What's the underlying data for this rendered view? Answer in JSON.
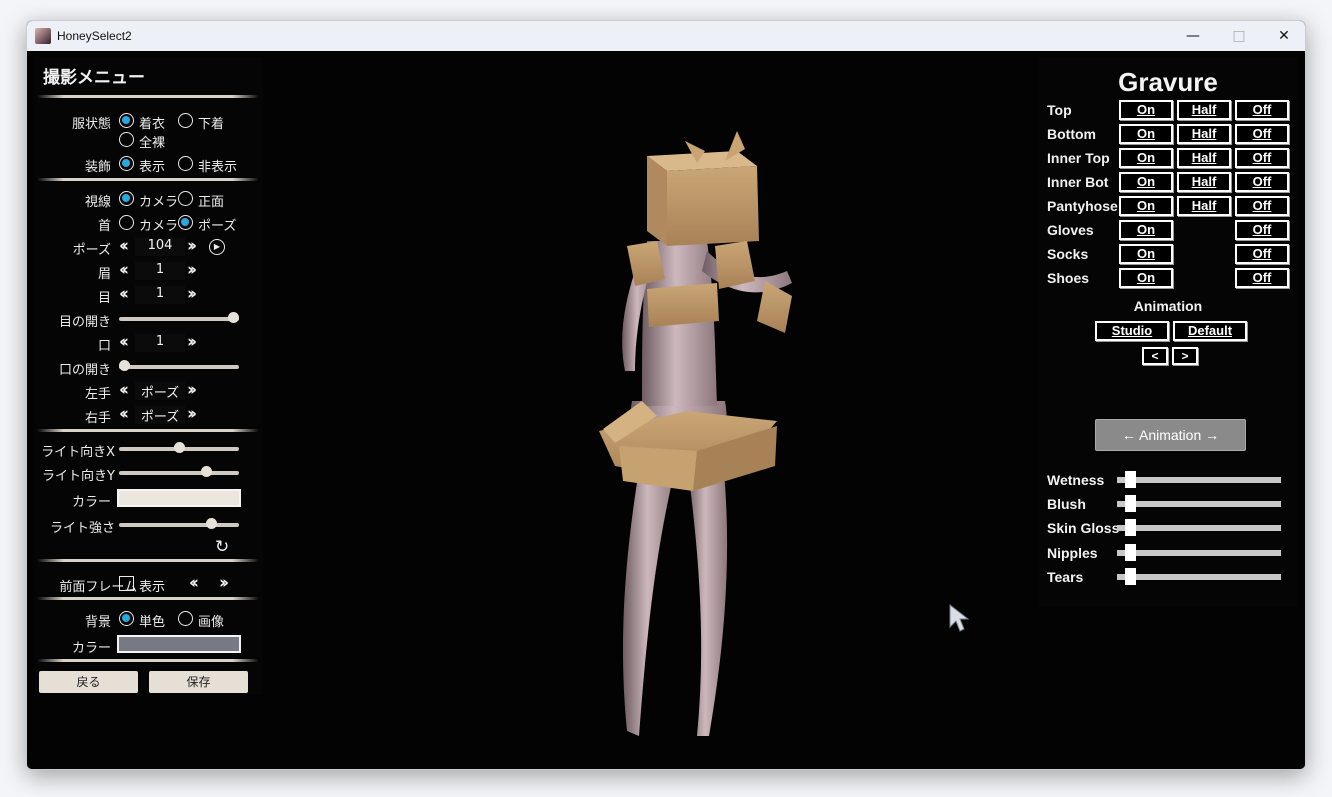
{
  "window": {
    "title": "HoneySelect2"
  },
  "left": {
    "title": "撮影メニュー",
    "clothing": {
      "label": "服状態",
      "opt1": "着衣",
      "opt2": "下着",
      "opt3": "全裸"
    },
    "accessory": {
      "label": "装飾",
      "opt1": "表示",
      "opt2": "非表示"
    },
    "gaze": {
      "label": "視線",
      "opt1": "カメラ",
      "opt2": "正面"
    },
    "neck": {
      "label": "首",
      "opt1": "カメラ",
      "opt2": "ポーズ"
    },
    "pose": {
      "label": "ポーズ",
      "value": "104"
    },
    "brow": {
      "label": "眉",
      "value": "1"
    },
    "eye": {
      "label": "目",
      "value": "1"
    },
    "eye_open": {
      "label": "目の開き",
      "value": 1.0
    },
    "mouth": {
      "label": "口",
      "value": "1"
    },
    "mouth_open": {
      "label": "口の開き",
      "value": 0.0
    },
    "left_hand": {
      "label": "左手",
      "value": "ポーズ"
    },
    "right_hand": {
      "label": "右手",
      "value": "ポーズ"
    },
    "light_x": {
      "label": "ライト向きX",
      "value": 0.5
    },
    "light_y": {
      "label": "ライト向きY",
      "value": 0.75
    },
    "light_color": {
      "label": "カラー",
      "color": "#ede6df"
    },
    "light_strength": {
      "label": "ライト強さ",
      "value": 0.8
    },
    "front_frame": {
      "label": "前面フレーム",
      "checkbox": "表示"
    },
    "background": {
      "label": "背景",
      "opt1": "単色",
      "opt2": "画像"
    },
    "bg_color": {
      "label": "カラー",
      "color": "#777a83"
    },
    "back_button": "戻る",
    "save_button": "保存"
  },
  "right": {
    "title": "Gravure",
    "on": "On",
    "half": "Half",
    "off": "Off",
    "rows": [
      {
        "label": "Top",
        "half": true
      },
      {
        "label": "Bottom",
        "half": true
      },
      {
        "label": "Inner Top",
        "half": true
      },
      {
        "label": "Inner Bot",
        "half": true
      },
      {
        "label": "Pantyhose",
        "half": true
      },
      {
        "label": "Gloves",
        "half": false
      },
      {
        "label": "Socks",
        "half": false
      },
      {
        "label": "Shoes",
        "half": false
      }
    ],
    "animation_label": "Animation",
    "studio": "Studio",
    "default": "Default",
    "prev": "<",
    "next": ">",
    "animation_button": "← Animation →",
    "sliders": [
      {
        "label": "Wetness",
        "value": 0.05
      },
      {
        "label": "Blush",
        "value": 0.05
      },
      {
        "label": "Skin Gloss",
        "value": 0.05
      },
      {
        "label": "Nipples",
        "value": 0.05
      },
      {
        "label": "Tears",
        "value": 0.05
      }
    ]
  }
}
